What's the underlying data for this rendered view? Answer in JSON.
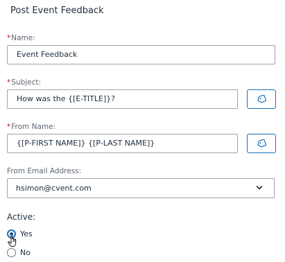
{
  "form": {
    "title": "Post Event Feedback",
    "required_marker": "*",
    "name": {
      "label": "Name:",
      "value": "Event Feedback"
    },
    "subject": {
      "label": "Subject:",
      "value": "How was the {[E-TITLE]}?"
    },
    "from_name": {
      "label": "From Name:",
      "value": "{[P-FIRST NAME]} {[P-LAST NAME]}"
    },
    "from_email": {
      "label": "From Email Address:",
      "value": "hsimon@cvent.com"
    },
    "active": {
      "label": "Active:",
      "options": [
        {
          "label": "Yes",
          "selected": true
        },
        {
          "label": "No",
          "selected": false
        }
      ]
    }
  },
  "icons": {
    "tag_button": "tag-icon",
    "dropdown": "chevron-down-icon",
    "cursor": "hand-pointer-icon"
  },
  "colors": {
    "accent": "#1a6fb6",
    "required": "#d0021b",
    "border": "#9aa4ad"
  }
}
